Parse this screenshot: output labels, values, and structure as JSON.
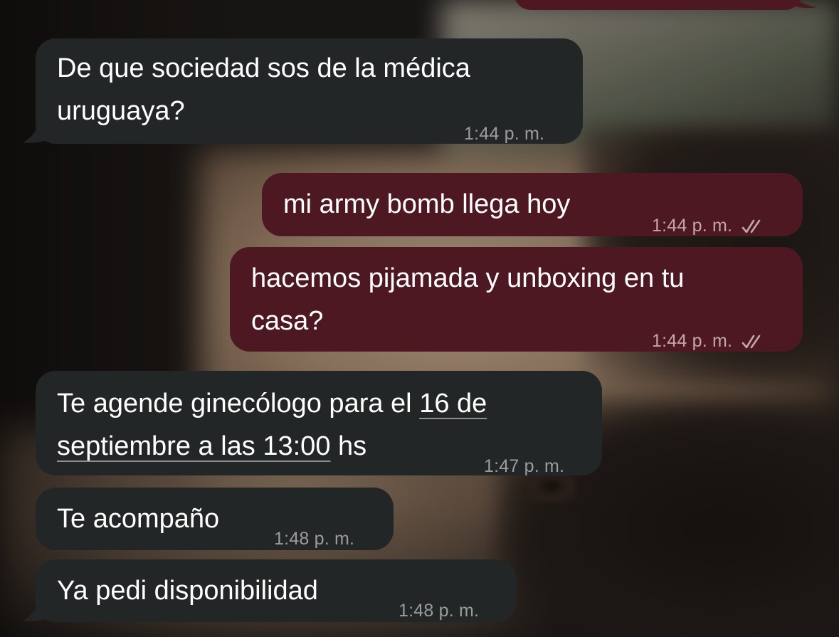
{
  "messages": [
    {
      "id": "m0",
      "direction": "outgoing",
      "lines": [
        ""
      ],
      "time": "",
      "read": false
    },
    {
      "id": "m1",
      "direction": "incoming",
      "lines": [
        "De que sociedad sos de la médica",
        "uruguaya?"
      ],
      "time": "1:44 p. m."
    },
    {
      "id": "m2",
      "direction": "outgoing",
      "lines": [
        "mi army bomb llega hoy"
      ],
      "time": "1:44 p. m.",
      "read": true
    },
    {
      "id": "m3",
      "direction": "outgoing",
      "lines": [
        "hacemos pijamada y unboxing en tu",
        "casa?"
      ],
      "time": "1:44 p. m.",
      "read": true
    },
    {
      "id": "m4",
      "direction": "incoming",
      "line1_plain": "Te agende ginecólogo para el ",
      "line1_link": "16 de",
      "line2_link": "septiembre a las 13:00",
      "line2_plain": " hs",
      "time": "1:47 p. m."
    },
    {
      "id": "m5",
      "direction": "incoming",
      "lines": [
        "Te acompaño"
      ],
      "time": "1:48 p. m."
    },
    {
      "id": "m6",
      "direction": "incoming",
      "lines": [
        "Ya pedi disponibilidad"
      ],
      "time": "1:48 p. m."
    }
  ],
  "colors": {
    "incoming_bubble": "#232627",
    "outgoing_bubble": "#4e1823",
    "timestamp": "#9b9c9e",
    "read_ticks": "#c3a6ab"
  },
  "icons": {
    "read_receipt": "double-check-icon"
  }
}
